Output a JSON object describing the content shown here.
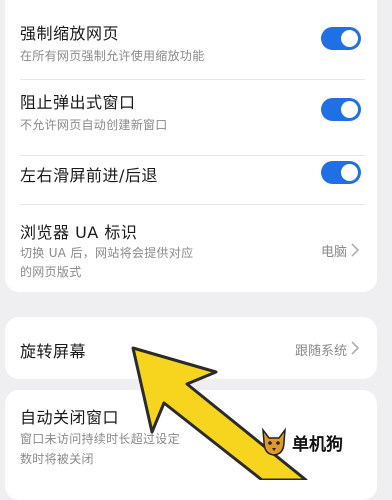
{
  "settings": {
    "force_zoom": {
      "title": "强制缩放网页",
      "subtitle": "在所有网页强制允许使用缩放功能",
      "enabled": true
    },
    "block_popups": {
      "title": "阻止弹出式窗口",
      "subtitle": "不允许网页自动创建新窗口",
      "enabled": true
    },
    "swipe_nav": {
      "title": "左右滑屏前进/后退",
      "enabled": true
    },
    "browser_ua": {
      "title": "浏览器 UA 标识",
      "subtitle_line1": "切换 UA 后，网站将会提供对应",
      "subtitle_line2": "的网页版式",
      "value": "电脑"
    },
    "rotate_screen": {
      "title": "旋转屏幕",
      "value": "跟随系统"
    },
    "auto_close": {
      "title": "自动关闭窗口",
      "subtitle_line1": "窗口未访问持续时长超过设定",
      "subtitle_line2": "数时将被关闭"
    }
  },
  "colors": {
    "toggle_on": "#1f6fe5",
    "arrow_fill": "#f7d51f",
    "arrow_outline": "#2b2b2b"
  },
  "watermark": {
    "text": "单机狗",
    "icon": "dog-logo-icon"
  }
}
